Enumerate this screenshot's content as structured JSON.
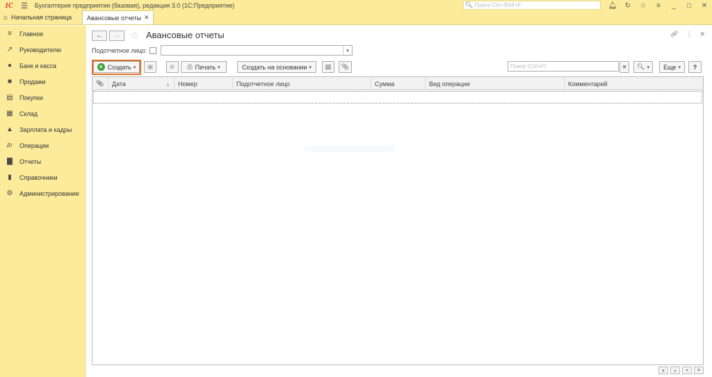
{
  "titlebar": {
    "logo": "1С",
    "title": "Бухгалтерия предприятия (базовая), редакция 3.0  (1С:Предприятие)",
    "search_placeholder": "Поиск Ctrl+Shift+F"
  },
  "tabs": {
    "home": "Начальная страница",
    "active": "Авансовые отчеты"
  },
  "sidebar": {
    "items": [
      {
        "label": "Главное",
        "icon": "menu-lines-icon"
      },
      {
        "label": "Руководителю",
        "icon": "trend-chart-icon"
      },
      {
        "label": "Банк и касса",
        "icon": "coins-icon"
      },
      {
        "label": "Продажи",
        "icon": "shopping-bag-icon"
      },
      {
        "label": "Покупки",
        "icon": "cart-icon"
      },
      {
        "label": "Склад",
        "icon": "warehouse-grid-icon"
      },
      {
        "label": "Зарплата и кадры",
        "icon": "person-icon"
      },
      {
        "label": "Операции",
        "icon": "debit-credit-icon"
      },
      {
        "label": "Отчеты",
        "icon": "bar-chart-icon"
      },
      {
        "label": "Справочники",
        "icon": "book-icon"
      },
      {
        "label": "Администрирование",
        "icon": "gear-icon"
      }
    ]
  },
  "form": {
    "title": "Авансовые отчеты",
    "filter_label": "Подотчетное лицо:",
    "buttons": {
      "create": "Создать",
      "print": "Печать",
      "create_based": "Создать на основании",
      "more": "Еще",
      "help": "?"
    },
    "search_placeholder": "Поиск (Ctrl+F)"
  },
  "table": {
    "columns": [
      "Дата",
      "Номер",
      "Подотчетное лицо",
      "Сумма",
      "Вид операции",
      "Комментарий"
    ]
  }
}
